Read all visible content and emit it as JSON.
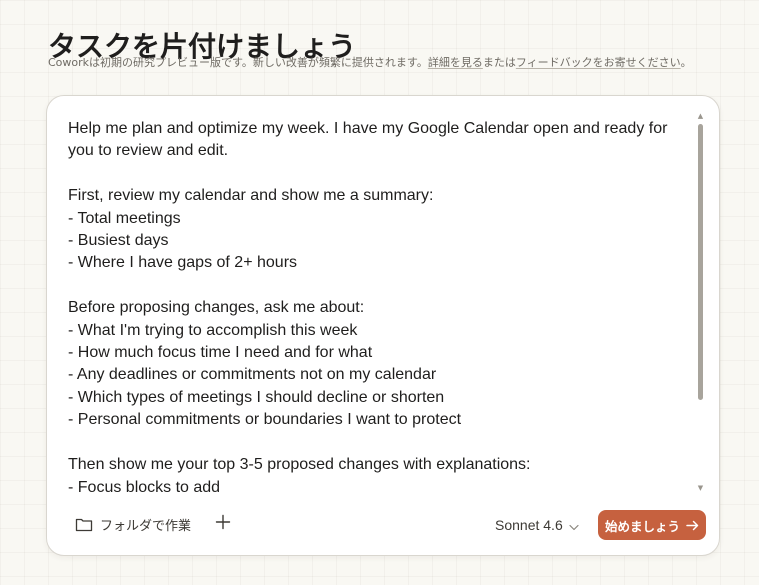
{
  "page": {
    "title": "タスクを片付けましょう"
  },
  "notice": {
    "text_before": "Coworkは初期の研究プレビュー版です。新しい改善が頻繁に提供されます。",
    "details_link": "詳細を見る",
    "text_middle": "または",
    "feedback_link": "フィードバックをお寄せください",
    "text_after": "。"
  },
  "composer": {
    "prompt_text": "Help me plan and optimize my week. I have my Google Calendar open and ready for you to review and edit.\n\nFirst, review my calendar and show me a summary:\n- Total meetings\n- Busiest days\n- Where I have gaps of 2+ hours\n\nBefore proposing changes, ask me about:\n- What I'm trying to accomplish this week\n- How much focus time I need and for what\n- Any deadlines or commitments not on my calendar\n- Which types of meetings I should decline or shorten\n- Personal commitments or boundaries I want to protect\n\nThen show me your top 3-5 proposed changes with explanations:\n- Focus blocks to add",
    "folder_button_label": "フォルダで作業",
    "model_label": "Sonnet 4.6",
    "start_button_label": "始めましょう",
    "icons": {
      "folder": "folder-icon",
      "add": "plus-icon",
      "model_dropdown": "chevron-down-icon",
      "start": "arrow-right-icon",
      "scroll_up": "triangle-up",
      "scroll_down": "triangle-down"
    }
  },
  "colors": {
    "background": "#f9f8f3",
    "accent": "#c6613f",
    "text": "#1f1e1d",
    "muted_text": "#6f6b64"
  }
}
